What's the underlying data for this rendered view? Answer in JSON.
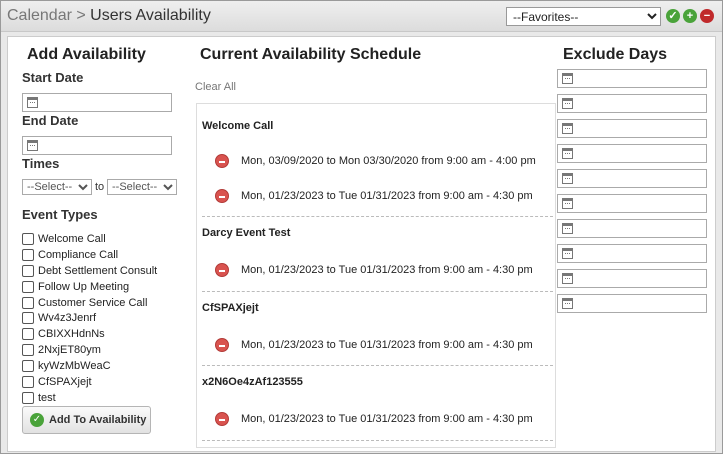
{
  "header": {
    "breadcrumb_parent": "Calendar",
    "breadcrumb_sep": " > ",
    "breadcrumb_current": "Users Availability",
    "favorites_selected": "--Favorites--",
    "icons": [
      "check-circle-icon",
      "plus-circle-icon",
      "minus-circle-icon"
    ]
  },
  "add": {
    "title": "Add Availability",
    "start_date_label": "Start Date",
    "end_date_label": "End Date",
    "times_label": "Times",
    "time_from_selected": "--Select--",
    "to_label": "to",
    "time_to_selected": "--Select--",
    "event_types_label": "Event Types",
    "event_types": [
      "Welcome Call",
      "Compliance Call",
      "Debt Settlement Consult",
      "Follow Up Meeting",
      "Customer Service Call",
      "Wv4z3Jenrf",
      "CBIXXHdnNs",
      "2NxjET80ym",
      "kyWzMbWeaC",
      "CfSPAXjejt",
      "test"
    ],
    "add_button_label": "Add To Availability"
  },
  "schedule": {
    "title": "Current Availability Schedule",
    "clear_all_label": "Clear All",
    "groups": [
      {
        "name": "Welcome Call",
        "entries": [
          "Mon, 03/09/2020 to Mon 03/30/2020 from 9:00 am - 4:00 pm",
          "Mon, 01/23/2023 to Tue 01/31/2023 from 9:00 am - 4:30 pm"
        ]
      },
      {
        "name": "Darcy Event Test",
        "entries": [
          "Mon, 01/23/2023 to Tue 01/31/2023 from 9:00 am - 4:30 pm"
        ]
      },
      {
        "name": "CfSPAXjejt",
        "entries": [
          "Mon, 01/23/2023 to Tue 01/31/2023 from 9:00 am - 4:30 pm"
        ]
      },
      {
        "name": "x2N6Oe4zAf123555",
        "entries": [
          "Mon, 01/23/2023 to Tue 01/31/2023 from 9:00 am - 4:30 pm"
        ]
      }
    ]
  },
  "exclude": {
    "title": "Exclude Days",
    "count": 10
  },
  "colors": {
    "accent_green": "#4aa33a",
    "remove_red": "#d9534f"
  }
}
